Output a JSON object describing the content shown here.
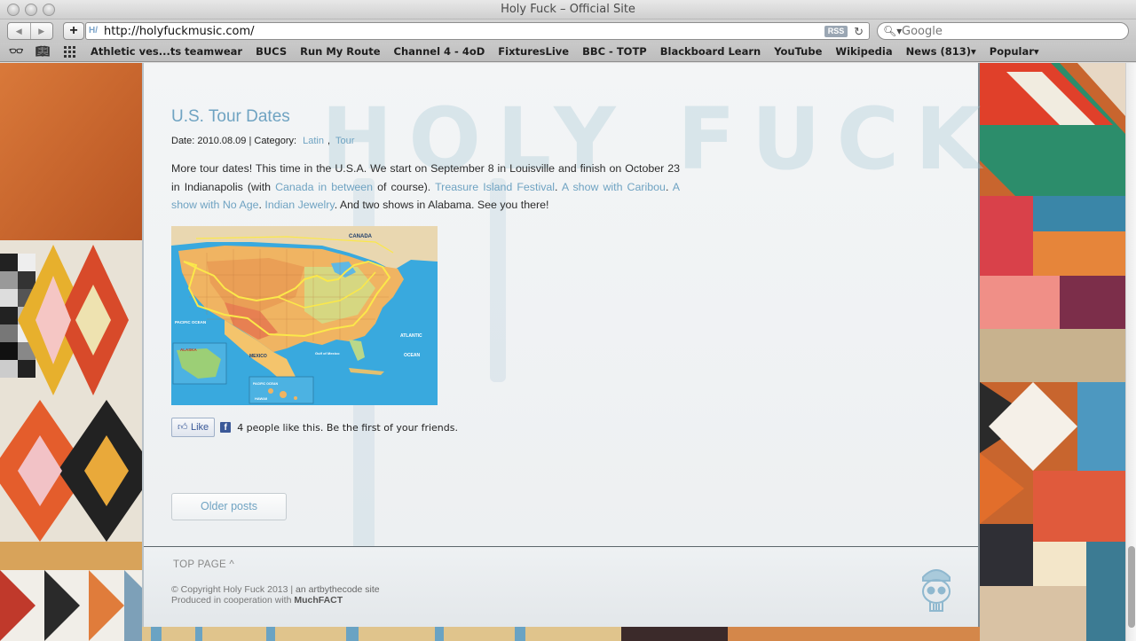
{
  "window": {
    "title": "Holy Fuck – Official Site"
  },
  "toolbar": {
    "back_icon": "back-arrow-icon",
    "forward_icon": "forward-arrow-icon",
    "add_label": "+",
    "url": "http://holyfuckmusic.com/",
    "rss_label": "RSS",
    "reload_icon": "reload-icon",
    "search_placeholder": "Google"
  },
  "bookmarks": {
    "items": [
      "Athletic ves...ts teamwear",
      "BUCS",
      "Run My Route",
      "Channel 4 - 4oD",
      "FixturesLive",
      "BBC - TOTP",
      "Blackboard Learn",
      "YouTube",
      "Wikipedia",
      "News (813)▾",
      "Popular▾"
    ]
  },
  "post": {
    "title": "U.S. Tour Dates",
    "meta_prefix": "Date: 2010.08.09 | Category:",
    "category_1": "Latin",
    "category_sep": ",",
    "category_2": "Tour",
    "body_1": "More tour dates! This time in the U.S.A. We start on September 8 in Louisville and finish on October 23 in Indianapolis (with ",
    "link_canada": "Canada in between",
    "body_2": " of course). ",
    "link_treasure": "Treasure Island Festival",
    "body_3": ". ",
    "link_caribou": "A show with Caribou",
    "body_4": ". ",
    "link_noage": "A show with No Age",
    "body_5": ". ",
    "link_jewelry": "Indian Jewelry",
    "body_6": ". And two shows in Alabama. See you there!",
    "map": {
      "labels": {
        "canada": "CANADA",
        "pacific": "PACIFIC OCEAN",
        "atlantic": "ATLANTIC",
        "atlantic_ocean": "OCEAN",
        "mexico": "MEXICO",
        "alaska": "ALASKA",
        "gulf": "Gulf of Mexico",
        "hawaii": "HAWAII",
        "pacific_lower": "PACIFIC OCEAN"
      }
    }
  },
  "facebook": {
    "like_label": "Like",
    "count_text": "4 people like this. Be the first of your friends."
  },
  "pagination": {
    "older_label": "Older posts"
  },
  "footer": {
    "top_link": "TOP PAGE ^",
    "copyright": "© Copyright Holy Fuck 2013 | ",
    "site_credit": "an artbythecode site",
    "produced": "Produced in cooperation with ",
    "muchfact": "MuchFACT"
  },
  "colors": {
    "link": "#6fa3c2",
    "facebook": "#3b5998"
  }
}
